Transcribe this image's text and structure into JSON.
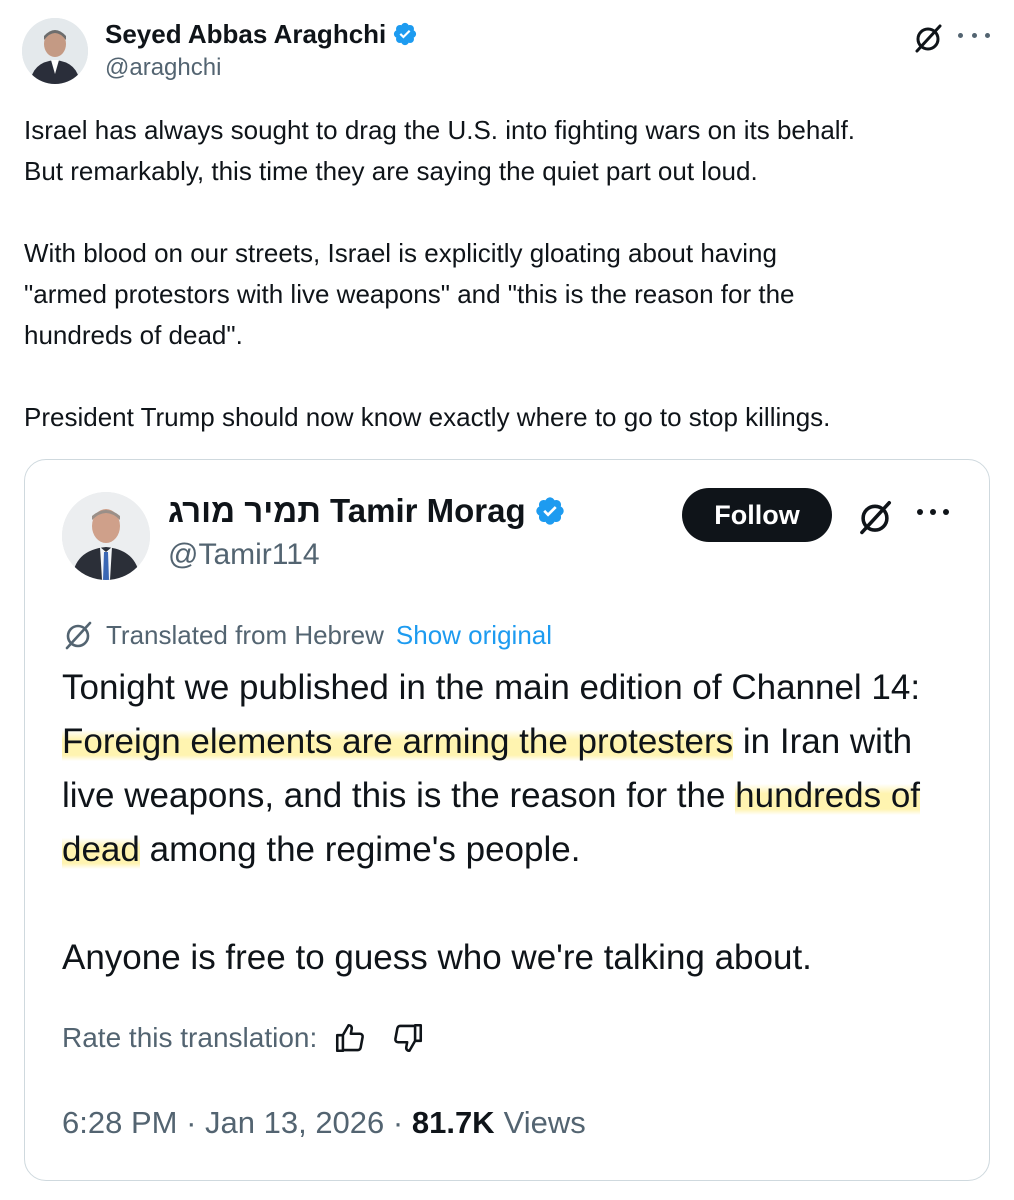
{
  "author": {
    "name": "Seyed Abbas Araghchi",
    "handle": "@araghchi"
  },
  "tweet": {
    "p1": "Israel has always sought to drag the U.S. into fighting wars on its behalf.\nBut remarkably, this time they are saying the quiet part out loud.",
    "p2": "With blood on our streets, Israel is explicitly gloating about having\n\"armed protestors with live weapons\" and \"this is the reason for the\nhundreds of dead\".",
    "p3": "President Trump should now know exactly where to go to stop killings."
  },
  "quoted": {
    "name": "תמיר מורג Tamir Morag",
    "handle": "@Tamir114",
    "follow_label": "Follow",
    "translated_from": "Translated from Hebrew",
    "show_original": "Show original",
    "text_a": "Tonight we published in the main edition of Channel 14: ",
    "text_b": "Foreign elements are arming the protesters",
    "text_c": " in Iran with live weapons, and this is the reason for the ",
    "text_d": "hundreds of dead",
    "text_e": " among the regime's people.",
    "text_2": "Anyone is free to guess who we're talking about.",
    "rate_label": "Rate this translation:",
    "time": "6:28 PM",
    "date": "Jan 13, 2026",
    "views_count": "81.7K",
    "views_label": "Views"
  },
  "colors": {
    "verified": "#1d9bf0",
    "link": "#1d9bf0",
    "muted": "#536471",
    "highlight": "#fff096"
  },
  "icons": [
    "grok-icon",
    "more-icon",
    "verified-badge-icon",
    "translate-icon",
    "thumbs-up-icon",
    "thumbs-down-icon"
  ]
}
